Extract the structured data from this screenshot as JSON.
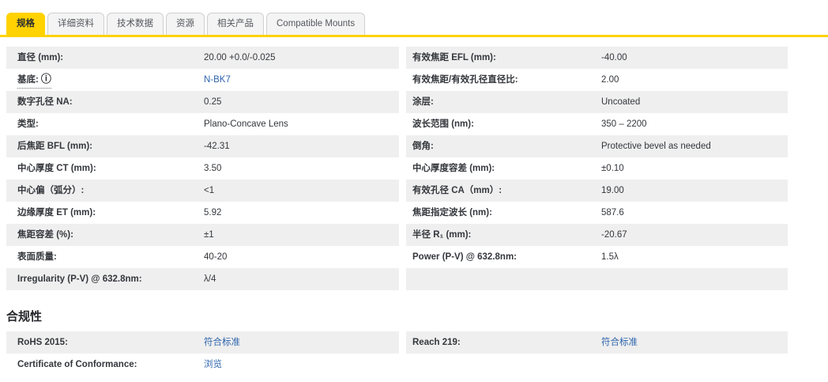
{
  "tabs": [
    {
      "label": "规格",
      "active": true
    },
    {
      "label": "详细资料",
      "active": false
    },
    {
      "label": "技术数据",
      "active": false
    },
    {
      "label": "资源",
      "active": false
    },
    {
      "label": "相关产品",
      "active": false
    },
    {
      "label": "Compatible Mounts",
      "active": false
    }
  ],
  "colors": {
    "accent_yellow": "#ffd200",
    "row_stripe": "#efefef",
    "link_blue": "#2e64ad",
    "text": "#34373c"
  },
  "spec_table": {
    "left_rows": [
      {
        "label": "直径 (mm):",
        "value": "20.00 +0.0/-0.025",
        "link": false
      },
      {
        "label": "基底:",
        "info": true,
        "value": "N-BK7",
        "link": true
      },
      {
        "label": "数字孔径 NA:",
        "value": "0.25",
        "link": false
      },
      {
        "label": "类型:",
        "value": "Plano-Concave Lens",
        "link": false
      },
      {
        "label": "后焦距 BFL (mm):",
        "value": "-42.31",
        "link": false
      },
      {
        "label": "中心厚度 CT (mm):",
        "value": "3.50",
        "link": false
      },
      {
        "label": "中心偏（弧分）:",
        "value": "<1",
        "link": false
      },
      {
        "label": "边缘厚度 ET (mm):",
        "value": "5.92",
        "link": false
      },
      {
        "label": "焦距容差 (%):",
        "value": "±1",
        "link": false
      },
      {
        "label": "表面质量:",
        "value": "40-20",
        "link": false
      },
      {
        "label": "Irregularity (P-V) @ 632.8nm:",
        "value": "λ/4",
        "link": false
      }
    ],
    "right_rows": [
      {
        "label": "有效焦距 EFL (mm):",
        "value": "-40.00",
        "link": false
      },
      {
        "label": "有效焦距/有效孔径直径比:",
        "value": "2.00",
        "link": false
      },
      {
        "label": "涂层:",
        "value": "Uncoated",
        "link": false
      },
      {
        "label": "波长范围 (nm):",
        "value": "350 – 2200",
        "link": false
      },
      {
        "label": "倒角:",
        "value": "Protective bevel as needed",
        "link": false
      },
      {
        "label": "中心厚度容差 (mm):",
        "value": "±0.10",
        "link": false
      },
      {
        "label": "有效孔径 CA（mm）:",
        "value": "19.00",
        "link": false
      },
      {
        "label": "焦距指定波长 (nm):",
        "value": "587.6",
        "link": false
      },
      {
        "label": "半径 R₁ (mm):",
        "value": "-20.67",
        "link": false
      },
      {
        "label": "Power (P-V) @ 632.8nm:",
        "value": "1.5λ",
        "link": false
      },
      {
        "label": "",
        "value": "",
        "link": false
      }
    ]
  },
  "compliance": {
    "heading": "合规性",
    "left_rows": [
      {
        "label": "RoHS 2015:",
        "value": "符合标准",
        "link": true
      },
      {
        "label": "Certificate of Conformance:",
        "value": "浏览",
        "link": true
      }
    ],
    "right_rows": [
      {
        "label": "Reach 219:",
        "value": "符合标准",
        "link": true
      }
    ]
  },
  "icons": {
    "info_icon": "ⓘ"
  }
}
